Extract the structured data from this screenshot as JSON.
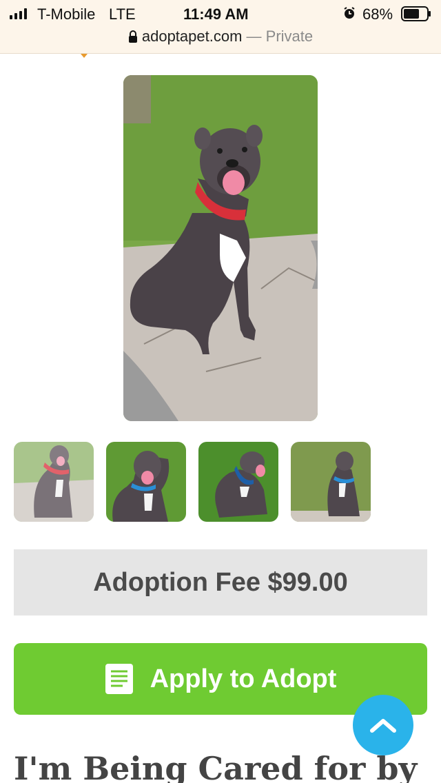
{
  "status_bar": {
    "carrier": "T-Mobile",
    "network": "LTE",
    "time": "11:49 AM",
    "battery": "68%",
    "battery_level": 0.68
  },
  "address_bar": {
    "host": "adoptapet.com",
    "separator": " — ",
    "mode": "Private"
  },
  "gallery": {
    "thumbnail_count": 4
  },
  "adoption": {
    "fee_label": "Adoption Fee $99.00",
    "apply_label": "Apply to Adopt"
  },
  "section": {
    "heading": "I'm Being Cared for by"
  },
  "colors": {
    "apply_green": "#6fcb32",
    "scroll_blue": "#2ab3ea",
    "fee_gray": "#e5e5e5"
  },
  "icons": {
    "lock": "lock-icon",
    "alarm": "alarm-icon",
    "apply": "document-icon",
    "scroll": "chevron-up-icon"
  }
}
